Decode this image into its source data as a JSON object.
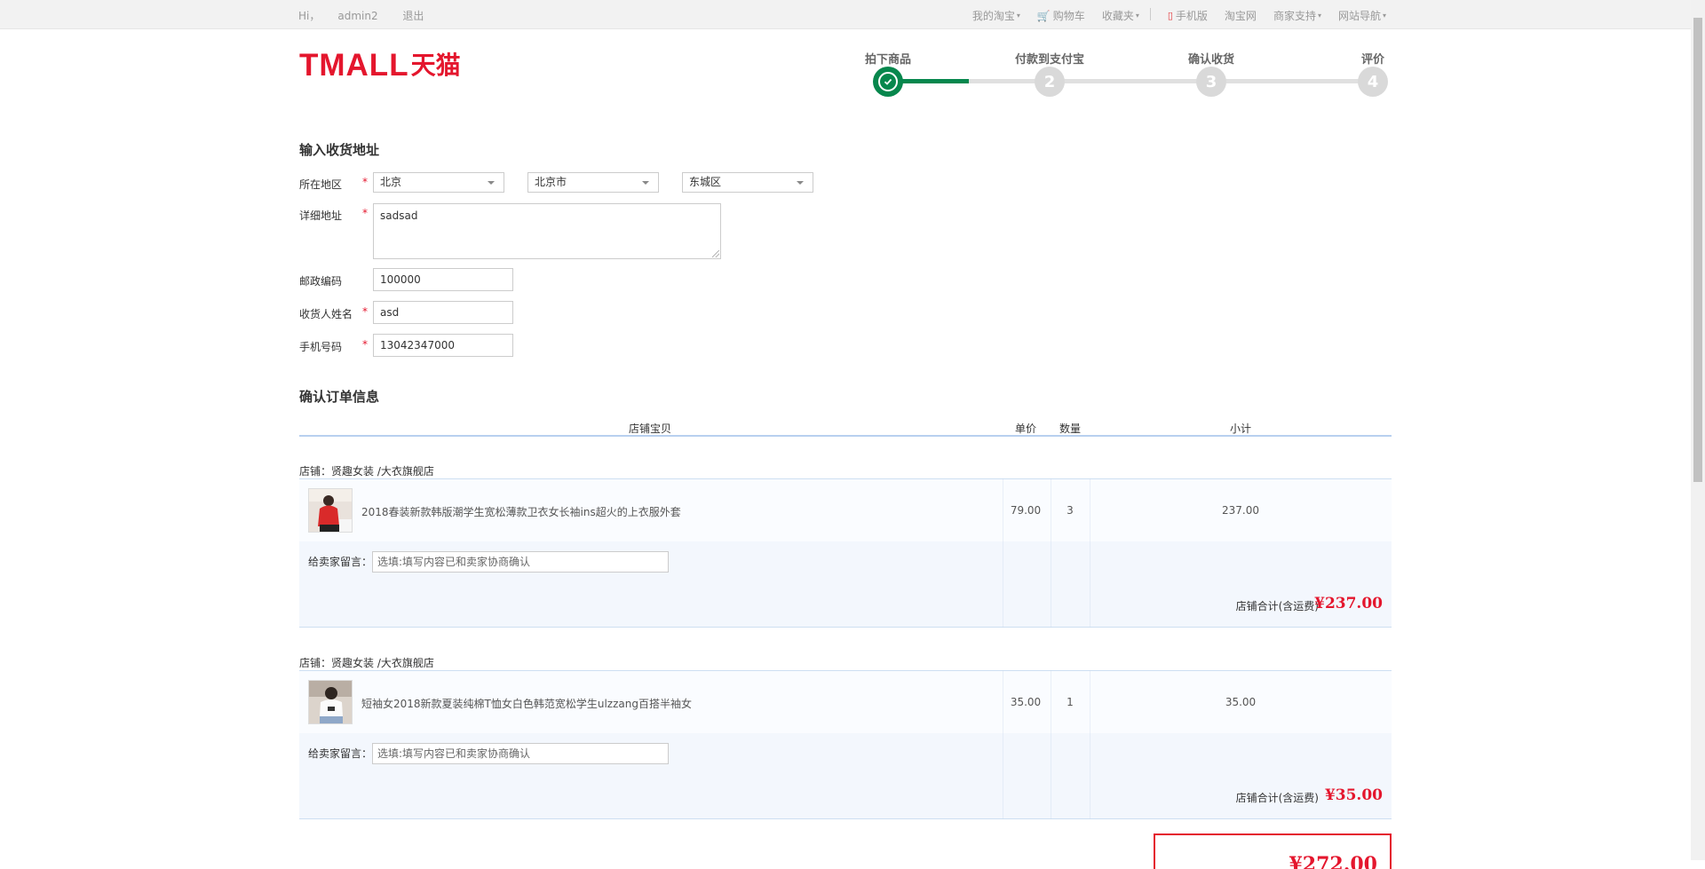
{
  "topbar": {
    "greeting": "Hi，",
    "username": "admin2",
    "logout": "退出",
    "links": {
      "my_taobao": "我的淘宝",
      "cart": "购物车",
      "favorites": "收藏夹",
      "mobile": "手机版",
      "taobao": "淘宝网",
      "merchant": "商家支持",
      "site_nav": "网站导航"
    }
  },
  "logo": {
    "latin": "TMALL",
    "chinese": "天猫"
  },
  "steps": [
    {
      "label": "拍下商品",
      "number": "1",
      "status": "done"
    },
    {
      "label": "付款到支付宝",
      "number": "2",
      "status": "pending"
    },
    {
      "label": "确认收货",
      "number": "3",
      "status": "pending"
    },
    {
      "label": "评价",
      "number": "4",
      "status": "pending"
    }
  ],
  "address": {
    "section_title": "输入收货地址",
    "region_label": "所在地区",
    "province": "北京",
    "city": "北京市",
    "district": "东城区",
    "detail_label": "详细地址",
    "detail_value": "sadsad",
    "postcode_label": "邮政编码",
    "postcode_value": "100000",
    "receiver_label": "收货人姓名",
    "receiver_value": "asd",
    "phone_label": "手机号码",
    "phone_value": "13042347000",
    "required_mark": "*"
  },
  "order": {
    "section_title": "确认订单信息",
    "columns": {
      "item": "店铺宝贝",
      "price": "单价",
      "qty": "数量",
      "subtotal": "小计"
    },
    "shops": [
      {
        "shop_label": "店铺：贤趣女装 /大衣旗舰店",
        "product_name": "2018春装新款韩版潮学生宽松薄款卫衣女长袖ins超火的上衣服外套",
        "price": "79.00",
        "qty": "3",
        "subtotal": "237.00",
        "msg_label": "给卖家留言：",
        "msg_placeholder": "选填:填写内容已和卖家协商确认",
        "total_label": "店铺合计(含运费)",
        "total_value": "¥237.00"
      },
      {
        "shop_label": "店铺：贤趣女装 /大衣旗舰店",
        "product_name": "短袖女2018新款夏装纯棉T恤女白色韩范宽松学生ulzzang百搭半袖女",
        "price": "35.00",
        "qty": "1",
        "subtotal": "35.00",
        "msg_label": "给卖家留言：",
        "msg_placeholder": "选填:填写内容已和卖家协商确认",
        "total_label": "店铺合计(含运费)",
        "total_value": "¥35.00"
      }
    ],
    "grand_total": "¥272.00"
  },
  "colors": {
    "brand_red": "#e4162d",
    "step_green": "#07874d"
  }
}
